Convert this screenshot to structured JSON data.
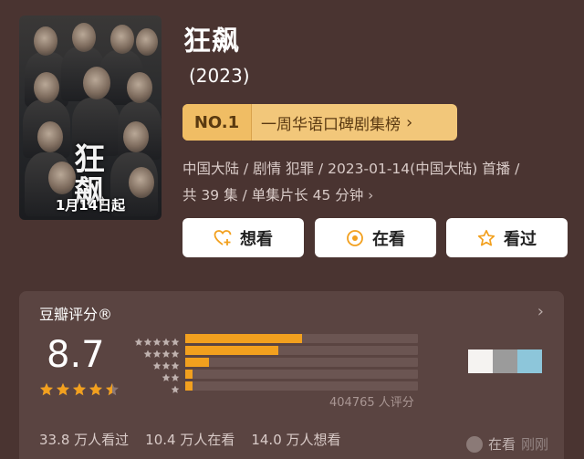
{
  "poster": {
    "title_text": "狂飙",
    "date_text": "1月14日起"
  },
  "show": {
    "title": "狂飙",
    "year": "(2023)"
  },
  "rank": {
    "badge": "NO.1",
    "label": "一周华语口碑剧集榜"
  },
  "meta": {
    "line1": "中国大陆 / 剧情 犯罪 / 2023-01-14(中国大陆) 首播 /",
    "line2": "共 39 集 / 单集片长 45 分钟"
  },
  "actions": {
    "want": "想看",
    "watching": "在看",
    "watched": "看过"
  },
  "rating": {
    "header": "豆瓣评分®",
    "score": "8.7",
    "stars_filled": 4.5,
    "distribution": [
      0.5,
      0.4,
      0.1,
      0.02,
      0.02
    ],
    "count_text": "404765 人评分",
    "swatch_colors": [
      "#f5f3f1",
      "#9b9b9b",
      "#8dc6da"
    ]
  },
  "stats": {
    "watched": "33.8 万人看过",
    "watching": "10.4 万人在看",
    "want": "14.0 万人想看"
  },
  "footer": {
    "status": "在看",
    "extra": "刚刚"
  },
  "colors": {
    "background": "#4a3431",
    "card": "#5a4441",
    "accent_orange": "#f2a01e",
    "rank_gold": "#f2c77a"
  },
  "icons": {
    "want": "heart-plus-icon",
    "watching": "target-icon",
    "watched": "star-outline-icon"
  }
}
